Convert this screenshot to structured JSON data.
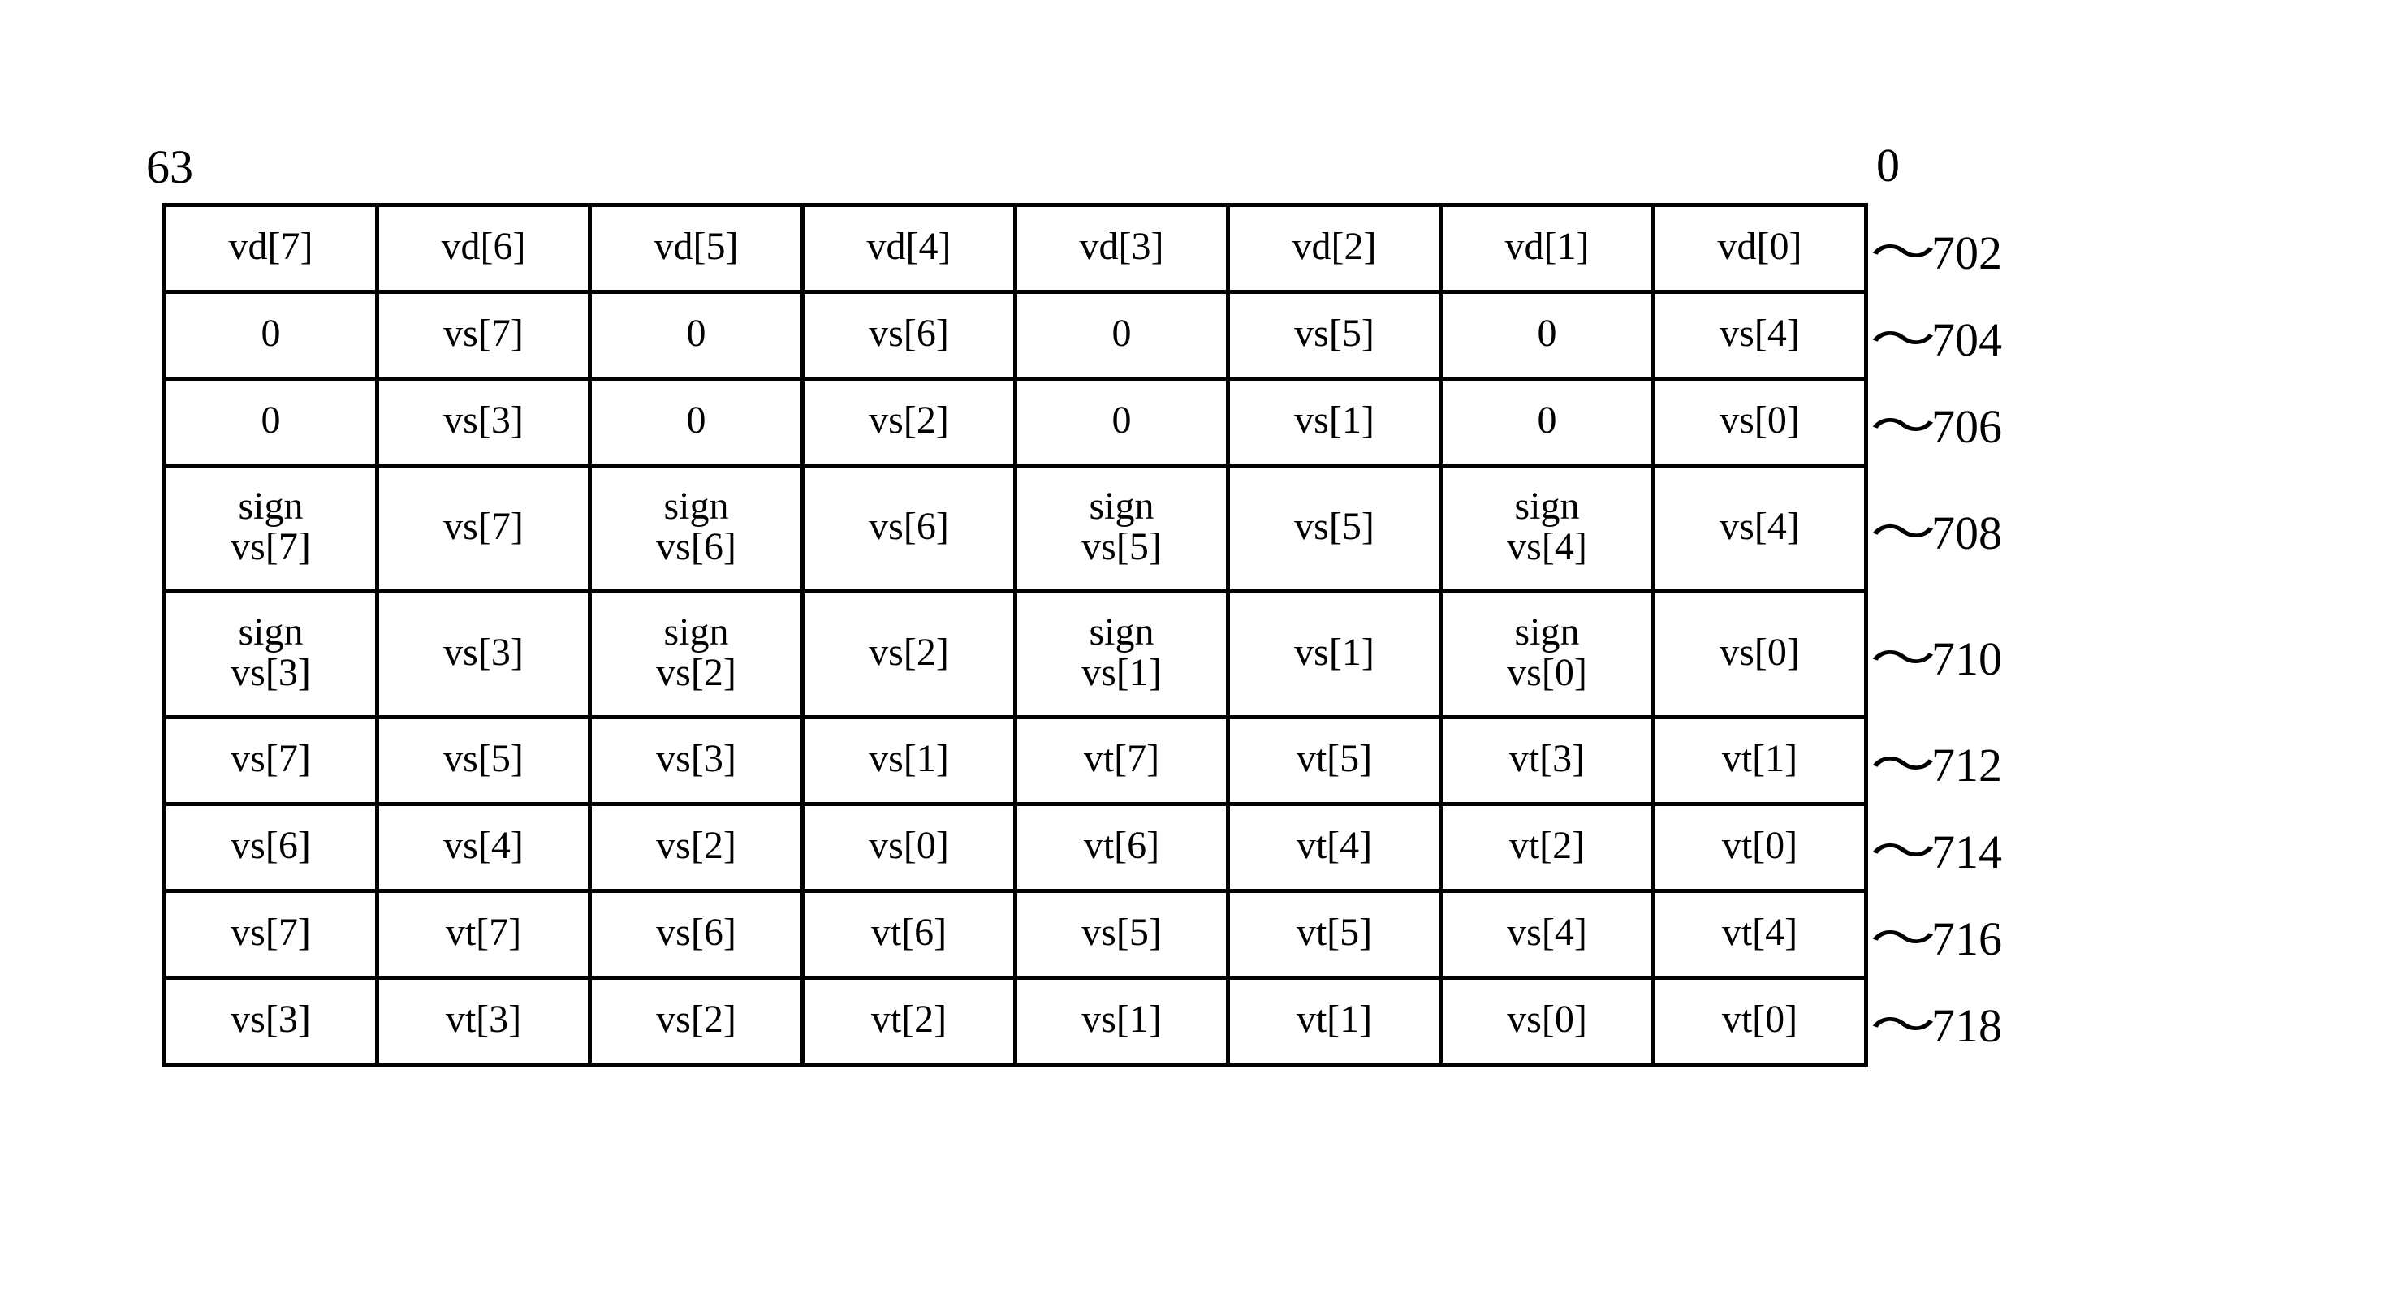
{
  "bits": {
    "msb": "63",
    "lsb": "0"
  },
  "rows": [
    {
      "ref": "702",
      "h": 1,
      "cells": [
        "vd[7]",
        "vd[6]",
        "vd[5]",
        "vd[4]",
        "vd[3]",
        "vd[2]",
        "vd[1]",
        "vd[0]"
      ]
    },
    {
      "ref": "704",
      "h": 1,
      "cells": [
        "0",
        "vs[7]",
        "0",
        "vs[6]",
        "0",
        "vs[5]",
        "0",
        "vs[4]"
      ]
    },
    {
      "ref": "706",
      "h": 1,
      "cells": [
        "0",
        "vs[3]",
        "0",
        "vs[2]",
        "0",
        "vs[1]",
        "0",
        "vs[0]"
      ]
    },
    {
      "ref": "708",
      "h": 2,
      "cells": [
        "sign\nvs[7]",
        "vs[7]",
        "sign\nvs[6]",
        "vs[6]",
        "sign\nvs[5]",
        "vs[5]",
        "sign\nvs[4]",
        "vs[4]"
      ]
    },
    {
      "ref": "710",
      "h": 2,
      "cells": [
        "sign\nvs[3]",
        "vs[3]",
        "sign\nvs[2]",
        "vs[2]",
        "sign\nvs[1]",
        "vs[1]",
        "sign\nvs[0]",
        "vs[0]"
      ]
    },
    {
      "ref": "712",
      "h": 1,
      "cells": [
        "vs[7]",
        "vs[5]",
        "vs[3]",
        "vs[1]",
        "vt[7]",
        "vt[5]",
        "vt[3]",
        "vt[1]"
      ]
    },
    {
      "ref": "714",
      "h": 1,
      "cells": [
        "vs[6]",
        "vs[4]",
        "vs[2]",
        "vs[0]",
        "vt[6]",
        "vt[4]",
        "vt[2]",
        "vt[0]"
      ]
    },
    {
      "ref": "716",
      "h": 1,
      "cells": [
        "vs[7]",
        "vt[7]",
        "vs[6]",
        "vt[6]",
        "vs[5]",
        "vt[5]",
        "vs[4]",
        "vt[4]"
      ]
    },
    {
      "ref": "718",
      "h": 1,
      "cells": [
        "vs[3]",
        "vt[3]",
        "vs[2]",
        "vt[2]",
        "vs[1]",
        "vt[1]",
        "vs[0]",
        "vt[0]"
      ]
    }
  ]
}
